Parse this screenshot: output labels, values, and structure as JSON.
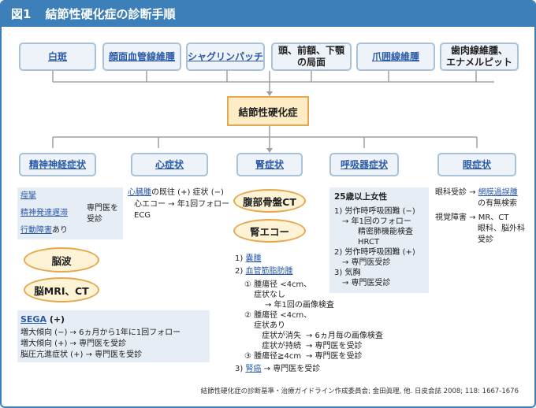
{
  "title": {
    "fig": "図1",
    "text": "結節性硬化症の診断手順"
  },
  "findings": [
    "白斑",
    "顔面血管線維腫",
    "シャグリンパッチ",
    "頭、前額、下顎の局面",
    "爪囲線維腫",
    "歯肉線維腫、エナメルピット"
  ],
  "finding_lines": {
    "f4": [
      "頭、前額、下顎",
      "の局面"
    ],
    "f6": [
      "歯肉線維腫、",
      "エナメルピット"
    ]
  },
  "center": "結節性硬化症",
  "categories": [
    "精神神経症状",
    "心症状",
    "腎症状",
    "呼吸器症状",
    "眼症状"
  ],
  "neuro": {
    "items": [
      "痙攣",
      "精神発達遅滞",
      "行動障害"
    ],
    "suffix": "あり",
    "referral": [
      "専門医を",
      "受診"
    ],
    "ovals": [
      "脳波",
      "脳MRI、CT"
    ],
    "sega": {
      "name": "SEGA",
      "plus": " (+)",
      "lines": [
        "増大傾向 (−) → 6ヵ月から1年に1回フォロー",
        "増大傾向 (+) → 専門医を受診",
        "脳圧亢進症状 (+) → 専門医を受診"
      ]
    }
  },
  "heart": {
    "rhabdo": "心臓腫",
    "line1_rest": "の既往 (+) 症状 (−)",
    "line2": "心エコー → 年1回フォロー",
    "line3": "ECG"
  },
  "kidney": {
    "ovals": [
      "腹部骨盤CT",
      "腎エコー"
    ],
    "item1_num": "1)",
    "item1": "嚢腫",
    "item2_num": "2)",
    "item2": "血管筋脂肪腫",
    "sub": [
      "① 腫瘍径 <4cm、",
      "症状なし",
      "→ 年1回の画像検査",
      "② 腫瘍径 <4cm、",
      "症状あり",
      "症状が消失",
      "→ 6ヵ月毎の画像検査",
      "症状が持続",
      "→ 専門医を受診",
      "③ 腫瘍径≧4cm",
      "→ 専門医を受診"
    ],
    "item3_num": "3)",
    "item3": "腎癌",
    "item3_rest": " → 専門医を受診"
  },
  "resp": {
    "heading": "25歳以上女性",
    "lines": [
      "1) 労作時呼吸困難 (−)",
      "→ 年1回のフォロー",
      "精密肺機能検査",
      "HRCT",
      "2) 労作時呼吸困難 (+)",
      "→ 専門医受診",
      "3) 気胸",
      "→ 専門医受診"
    ]
  },
  "eye": {
    "line1_pre": "眼科受診 → ",
    "line1_link": "網膜過誤腫",
    "line2": "の有無検索",
    "line3": "視覚障害 → MR、CT",
    "line4": "眼科、脳外科",
    "line5": "受診"
  },
  "citation": "結節性硬化症の診断基準・治療ガイドライン作成委員会; 金田眞理, 他. 日皮会誌 2008; 118: 1667-1676",
  "colors": {
    "header": "#3d7fb8",
    "box_border": "#a9c2d8",
    "box_fill": "#eef3f9",
    "panel": "#e6edf5",
    "oval_border": "#e5a850",
    "oval_fill": "#fff3d6",
    "link": "#2a5aa8"
  }
}
